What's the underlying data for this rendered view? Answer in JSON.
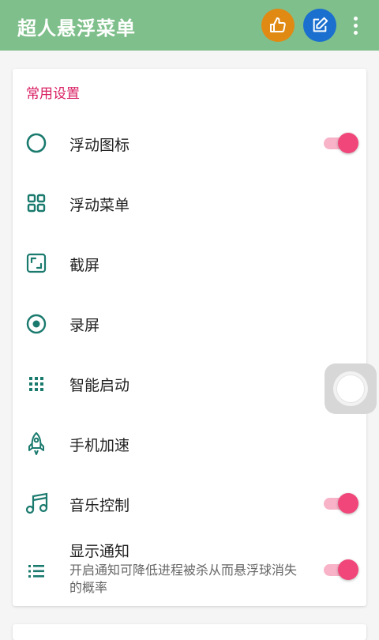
{
  "header": {
    "title": "超人悬浮菜单",
    "actions": [
      {
        "name": "like",
        "icon": "thumbs-up-icon",
        "color": "#e08a14"
      },
      {
        "name": "edit",
        "icon": "edit-icon",
        "color": "#1a6fcf"
      },
      {
        "name": "more",
        "icon": "more-vert-icon"
      }
    ],
    "bar_color": "#7fbf8b"
  },
  "settings": {
    "section_title": "常用设置",
    "accent_color": "#d81b60",
    "items": [
      {
        "label": "浮动图标",
        "icon": "circle-outline-icon",
        "toggle": true,
        "toggle_on": true
      },
      {
        "label": "浮动菜单",
        "icon": "grid-menu-icon",
        "toggle": false
      },
      {
        "label": "截屏",
        "icon": "screenshot-icon",
        "toggle": false
      },
      {
        "label": "录屏",
        "icon": "record-icon",
        "toggle": false
      },
      {
        "label": "智能启动",
        "icon": "dots-grid-icon",
        "toggle": false
      },
      {
        "label": "手机加速",
        "icon": "rocket-icon",
        "toggle": false
      },
      {
        "label": "音乐控制",
        "icon": "music-note-icon",
        "toggle": true,
        "toggle_on": true
      },
      {
        "label": "显示通知",
        "description": "开启通知可降低进程被杀从而悬浮球消失的概率",
        "icon": "list-icon",
        "toggle": true,
        "toggle_on": true
      }
    ]
  },
  "floating_ball": {
    "icon": "floating-ball-icon"
  }
}
